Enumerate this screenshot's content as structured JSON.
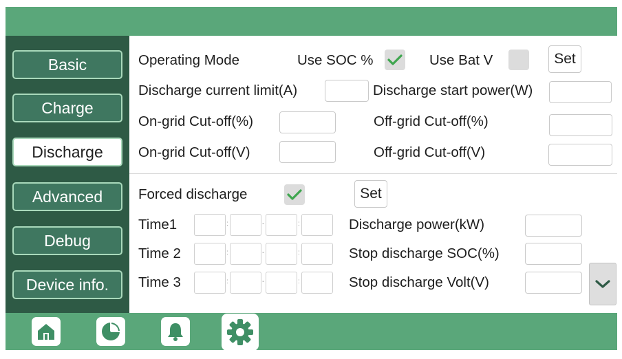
{
  "sidebar": {
    "items": [
      {
        "label": "Basic"
      },
      {
        "label": "Charge"
      },
      {
        "label": "Discharge"
      },
      {
        "label": "Advanced"
      },
      {
        "label": "Debug"
      },
      {
        "label": "Device info."
      }
    ],
    "active": "Discharge"
  },
  "operating": {
    "mode_label": "Operating Mode",
    "use_soc_label": "Use SOC %",
    "use_soc_checked": true,
    "use_batv_label": "Use Bat V",
    "use_batv_checked": false,
    "set_label": "Set"
  },
  "limits": {
    "discharge_current_label": "Discharge current limit(A)",
    "discharge_current_value": "",
    "discharge_start_power_label": "Discharge start power(W)",
    "discharge_start_power_value": "",
    "ongrid_cutoff_pct_label": "On-grid Cut-off(%)",
    "ongrid_cutoff_pct_value": "",
    "offgrid_cutoff_pct_label": "Off-grid Cut-off(%)",
    "offgrid_cutoff_pct_value": "",
    "ongrid_cutoff_v_label": "On-grid Cut-off(V)",
    "ongrid_cutoff_v_value": "",
    "offgrid_cutoff_v_label": "Off-grid Cut-off(V)",
    "offgrid_cutoff_v_value": ""
  },
  "forced": {
    "label": "Forced discharge",
    "checked": true,
    "set_label": "Set",
    "times": [
      {
        "label": "Time1"
      },
      {
        "label": "Time 2"
      },
      {
        "label": "Time 3"
      }
    ],
    "discharge_power_label": "Discharge power(kW)",
    "discharge_power_value": "",
    "stop_soc_label": "Stop discharge SOC(%)",
    "stop_soc_value": "",
    "stop_volt_label": "Stop discharge Volt(V)",
    "stop_volt_value": ""
  },
  "colors": {
    "bar_green": "#5aa77a",
    "sidebar_dark": "#2e5a45",
    "button_green": "#3f7760",
    "check_green": "#3fa64f"
  },
  "bottom_nav": [
    "home-icon",
    "pie-chart-icon",
    "bell-icon",
    "settings-gear-icon"
  ]
}
